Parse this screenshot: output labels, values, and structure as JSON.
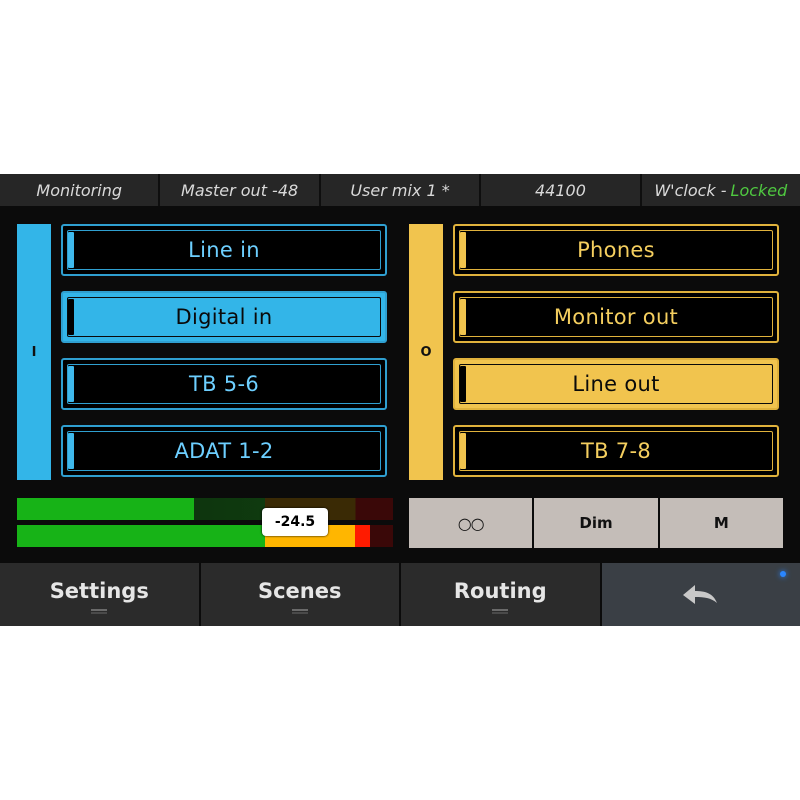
{
  "status_bar": {
    "mode": "Monitoring",
    "master": "Master out -48",
    "mix": "User mix 1 *",
    "sample_rate": "44100",
    "wordclock_label": "W'clock -",
    "wordclock_state": "Locked",
    "locked_color": "#4fc840"
  },
  "inputs": {
    "side_label": "I",
    "color": "#33b5e8",
    "items": [
      "Line in",
      "Digital in",
      "TB 5-6",
      "ADAT 1-2"
    ],
    "selected": "Digital in"
  },
  "outputs": {
    "side_label": "O",
    "color": "#f1c44e",
    "items": [
      "Phones",
      "Monitor out",
      "Line out",
      "TB 7-8"
    ],
    "selected": "Line out"
  },
  "meter": {
    "readout": "-24.5",
    "levels": [
      0.47,
      0.94
    ]
  },
  "monitor_buttons": {
    "link_icon": "link-icon",
    "dim": "Dim",
    "mute": "M"
  },
  "nav": {
    "settings": "Settings",
    "scenes": "Scenes",
    "routing": "Routing",
    "back_icon": "back-arrow-icon"
  }
}
